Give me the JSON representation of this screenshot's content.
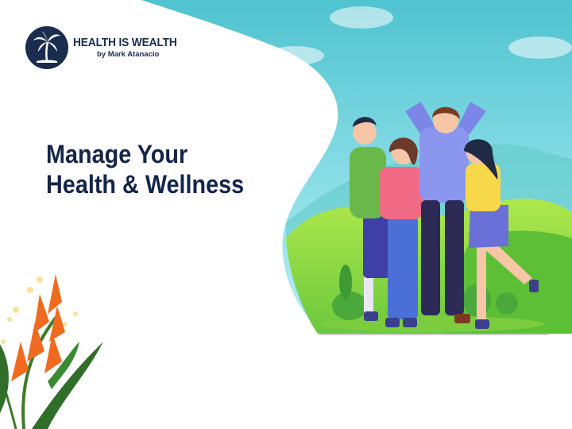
{
  "logo": {
    "title": "HEALTH IS WEALTH",
    "subtitle": "by Mark Atanacio",
    "icon": "palm-tree-icon"
  },
  "headline": {
    "line1": "Manage Your",
    "line2": "Health & Wellness"
  },
  "illustration": {
    "subject": "four-friends-cheering-icon",
    "decor": "heliconia-plant-icon"
  },
  "colors": {
    "navy": "#14254a",
    "sky": "#6dd3df",
    "grass": "#8fd14f"
  }
}
